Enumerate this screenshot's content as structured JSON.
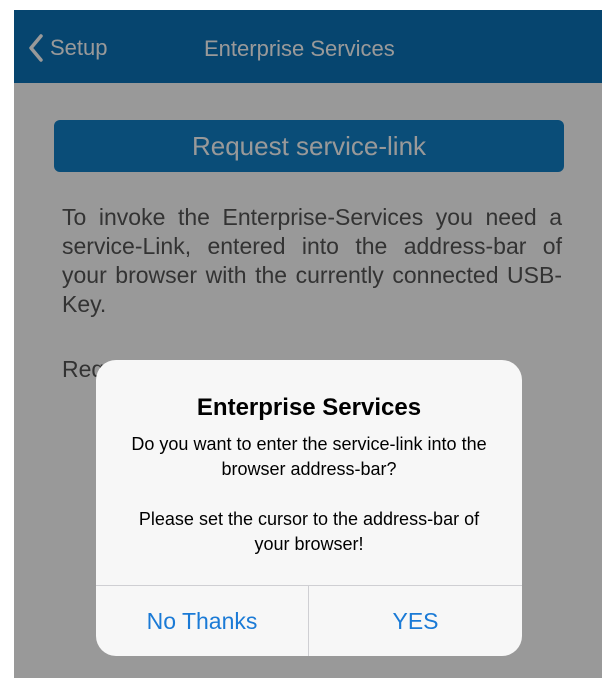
{
  "navbar": {
    "back_label": "Setup",
    "title": "Enterprise Services",
    "background_color": "#0a74b9"
  },
  "main": {
    "request_button_label": "Request service-link",
    "description": "To invoke the Enterprise-Services you need a service-Link, entered into the address-bar of your browser with the currently connected USB-Key.",
    "hint_visible": "Req"
  },
  "alert": {
    "title": "Enterprise Services",
    "message_line1": "Do you want to enter the service-link into the browser address-bar?",
    "message_line2": "Please set the cursor to the address-bar of your browser!",
    "cancel_label": "No Thanks",
    "confirm_label": "YES",
    "button_color": "#1a7ad6"
  },
  "icons": {
    "back": "chevron-left-icon"
  }
}
